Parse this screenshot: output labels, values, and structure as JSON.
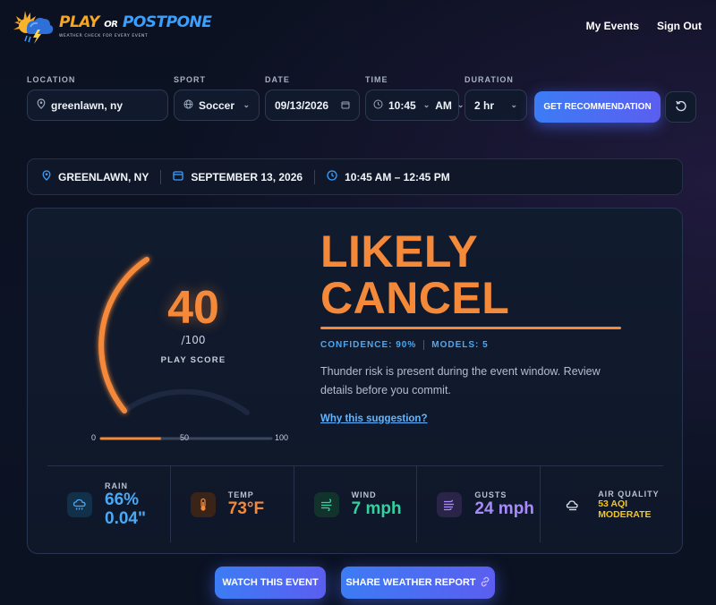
{
  "header": {
    "logo": {
      "word1": "PLAY",
      "word2": "OR",
      "word3": "POSTPONE",
      "tagline": "WEATHER CHECK FOR EVERY EVENT"
    },
    "nav": [
      "My Events",
      "Sign Out"
    ]
  },
  "form": {
    "location": {
      "label": "LOCATION",
      "value": "greenlawn, ny"
    },
    "sport": {
      "label": "SPORT",
      "value": "Soccer"
    },
    "date": {
      "label": "DATE",
      "value": "09/13/2026"
    },
    "time": {
      "label": "TIME",
      "hour": "10:45",
      "ampm": "AM"
    },
    "duration": {
      "label": "DURATION",
      "value": "2 hr"
    },
    "submit_label": "GET RECOMMENDATION"
  },
  "info": {
    "location": "GREENLAWN, NY",
    "date": "SEPTEMBER 13, 2026",
    "time": "10:45 AM – 12:45 PM"
  },
  "result": {
    "score": "40",
    "score_max": "/100",
    "score_label": "PLAY SCORE",
    "score_fraction": 0.4,
    "scale": [
      "0",
      "50",
      "100"
    ],
    "verdict_line1": "LIKELY",
    "verdict_line2": "CANCEL",
    "confidence": "CONFIDENCE: 90%",
    "models": "MODELS: 5",
    "description": "Thunder risk is present during the event window. Review details before you commit.",
    "why_link": "Why this suggestion?"
  },
  "stats": {
    "rain": {
      "label": "RAIN",
      "pct": "66%",
      "amount": "0.04\"",
      "icon": "rain-cloud-icon",
      "color": "#4aa8f5"
    },
    "temp": {
      "label": "TEMP",
      "value": "73°F",
      "icon": "thermometer-icon",
      "color": "#f5893a"
    },
    "wind": {
      "label": "WIND",
      "value": "7 mph",
      "icon": "wind-icon",
      "color": "#34d1a0"
    },
    "gusts": {
      "label": "GUSTS",
      "value": "24 mph",
      "icon": "gust-icon",
      "color": "#a78bfa"
    },
    "air": {
      "label": "AIR QUALITY",
      "aqi": "53 AQI",
      "level": "MODERATE",
      "icon": "air-icon",
      "color": "#f5c518"
    }
  },
  "actions": {
    "watch": "WATCH THIS EVENT",
    "share": "SHARE WEATHER REPORT"
  },
  "colors": {
    "accent": "#f5893a",
    "primary": "#3c7cf4"
  }
}
